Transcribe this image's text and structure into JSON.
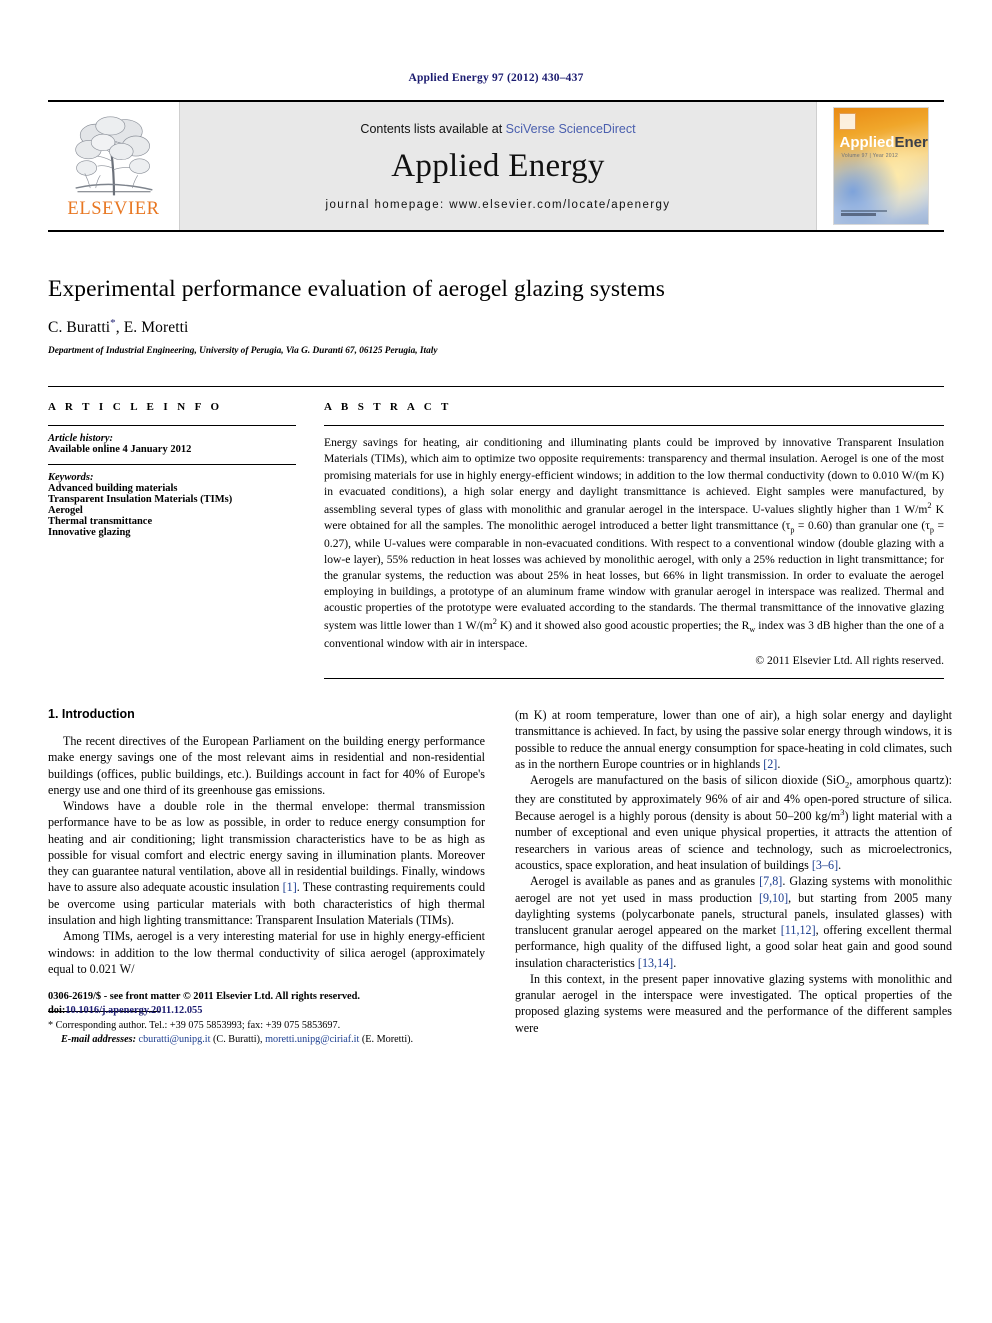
{
  "running_head": "Applied Energy 97 (2012) 430–437",
  "masthead": {
    "contents_prefix": "Contents lists available at ",
    "contents_link": "SciVerse ScienceDirect",
    "journal_title": "Applied Energy",
    "homepage": "journal homepage: www.elsevier.com/locate/apenergy",
    "publisher_logo_label": "ELSEVIER",
    "cover": {
      "title_part1": "Applied",
      "title_part2": "Energy",
      "subtitle": "Volume 97  |  Year 2012"
    }
  },
  "article": {
    "title": "Experimental performance evaluation of aerogel glazing systems",
    "authors": "C. Buratti",
    "author_marker": "*",
    "authors_rest": ", E. Moretti",
    "affiliation": "Department of Industrial Engineering, University of Perugia, Via G. Duranti 67, 06125 Perugia, Italy"
  },
  "info": {
    "heading": "A R T I C L E   I N F O",
    "history_label": "Article history:",
    "history_value": "Available online 4 January 2012",
    "keywords_label": "Keywords:",
    "keywords": [
      "Advanced building materials",
      "Transparent Insulation Materials (TIMs)",
      "Aerogel",
      "Thermal transmittance",
      "Innovative glazing"
    ]
  },
  "abstract": {
    "heading": "A B S T R A C T",
    "p1_a": "Energy savings for heating, air conditioning and illuminating plants could be improved by innovative Transparent Insulation Materials (TIMs), which aim to optimize two opposite requirements: transparency and thermal insulation. Aerogel is one of the most promising materials for use in highly energy-efficient windows; in addition to the low thermal conductivity (down to 0.010 W/(m K) in evacuated conditions), a high solar energy and daylight transmittance is achieved. Eight samples were manufactured, by assembling several types of glass with monolithic and granular aerogel in the interspace. U-values slightly higher than 1 W/m",
    "p1_sup1": "2",
    "p1_b": " K were obtained for all the samples. The monolithic aerogel introduced a better light transmittance (τ",
    "p1_sub1": "p",
    "p1_c": " = 0.60) than granular one (τ",
    "p1_sub2": "p",
    "p1_d": " = 0.27), while U-values were comparable in non-evacuated conditions. With respect to a conventional window (double glazing with a low-e layer), 55% reduction in heat losses was achieved by monolithic aerogel, with only a 25% reduction in light transmittance; for the granular systems, the reduction was about 25% in heat losses, but 66% in light transmission. In order to evaluate the aerogel employing in buildings, a prototype of an aluminum frame window with granular aerogel in interspace was realized. Thermal and acoustic properties of the prototype were evaluated according to the standards. The thermal transmittance of the innovative glazing system was little lower than 1 W/(m",
    "p1_sup2": "2",
    "p1_e": " K) and it showed also good acoustic properties; the R",
    "p1_sub3": "w",
    "p1_f": " index was 3 dB higher than the one of a conventional window with air in interspace.",
    "copyright": "© 2011 Elsevier Ltd. All rights reserved."
  },
  "body": {
    "section_title": "1. Introduction",
    "left": {
      "p1": "The recent directives of the European Parliament on the building energy performance make energy savings one of the most relevant aims in residential and non-residential buildings (offices, public buildings, etc.). Buildings account in fact for 40% of Europe's energy use and one third of its greenhouse gas emissions.",
      "p2_a": "Windows have a double role in the thermal envelope: thermal transmission performance have to be as low as possible, in order to reduce energy consumption for heating and air conditioning; light transmission characteristics have to be as high as possible for visual comfort and electric energy saving in illumination plants. Moreover they can guarantee natural ventilation, above all in residential buildings. Finally, windows have to assure also adequate acoustic insulation ",
      "p2_ref": "[1]",
      "p2_b": ". These contrasting requirements could be overcome using particular materials with both characteristics of high thermal insulation and high lighting transmittance: Transparent Insulation Materials (TIMs).",
      "p3": "Among TIMs, aerogel is a very interesting material for use in highly energy-efficient windows: in addition to the low thermal conductivity of silica aerogel (approximately equal to 0.021 W/"
    },
    "right": {
      "p1_cont": "(m K) at room temperature, lower than one of air), a high solar energy and daylight transmittance is achieved. In fact, by using the passive solar energy through windows, it is possible to reduce the annual energy consumption for space-heating in cold climates, such as in the northern Europe countries or in highlands ",
      "p1_ref": "[2]",
      "p1_end": ".",
      "p2_a": "Aerogels are manufactured on the basis of silicon dioxide (SiO",
      "p2_sub": "2",
      "p2_b": ", amorphous quartz): they are constituted by approximately 96% of air and 4% open-pored structure of silica. Because aerogel is a highly porous (density is about 50–200 kg/m",
      "p2_sup": "3",
      "p2_c": ") light material with a number of exceptional and even unique physical properties, it attracts the attention of researchers in various areas of science and technology, such as microelectronics, acoustics, space exploration, and heat insulation of buildings ",
      "p2_ref": "[3–6]",
      "p2_end": ".",
      "p3_a": "Aerogel is available as panes and as granules ",
      "p3_ref1": "[7,8]",
      "p3_b": ". Glazing systems with monolithic aerogel are not yet used in mass production ",
      "p3_ref2": "[9,10]",
      "p3_c": ", but starting from 2005 many daylighting systems (polycarbonate panels, structural panels, insulated glasses) with translucent granular aerogel appeared on the market ",
      "p3_ref3": "[11,12]",
      "p3_d": ", offering excellent thermal performance, high quality of the diffused light, a good solar heat gain and good sound insulation characteristics ",
      "p3_ref4": "[13,14]",
      "p3_end": ".",
      "p4": "In this context, in the present paper innovative glazing systems with monolithic and granular aerogel in the interspace were investigated. The optical properties of the proposed glazing systems were measured and the performance of the different samples were"
    }
  },
  "footnote": {
    "corresponding": "* Corresponding author. Tel.: +39 075 5853993; fax: +39 075 5853697.",
    "email_label": "E-mail addresses:",
    "email1": "cburatti@unipg.it",
    "email1_owner": " (C. Buratti), ",
    "email2": "moretti.unipg@ciriaf.it",
    "email2_owner": " (E. Moretti)."
  },
  "page_footer": {
    "issn_line": "0306-2619/$ - see front matter © 2011 Elsevier Ltd. All rights reserved.",
    "doi_label": "doi:",
    "doi_value": "10.1016/j.apenergy.2011.12.055"
  }
}
